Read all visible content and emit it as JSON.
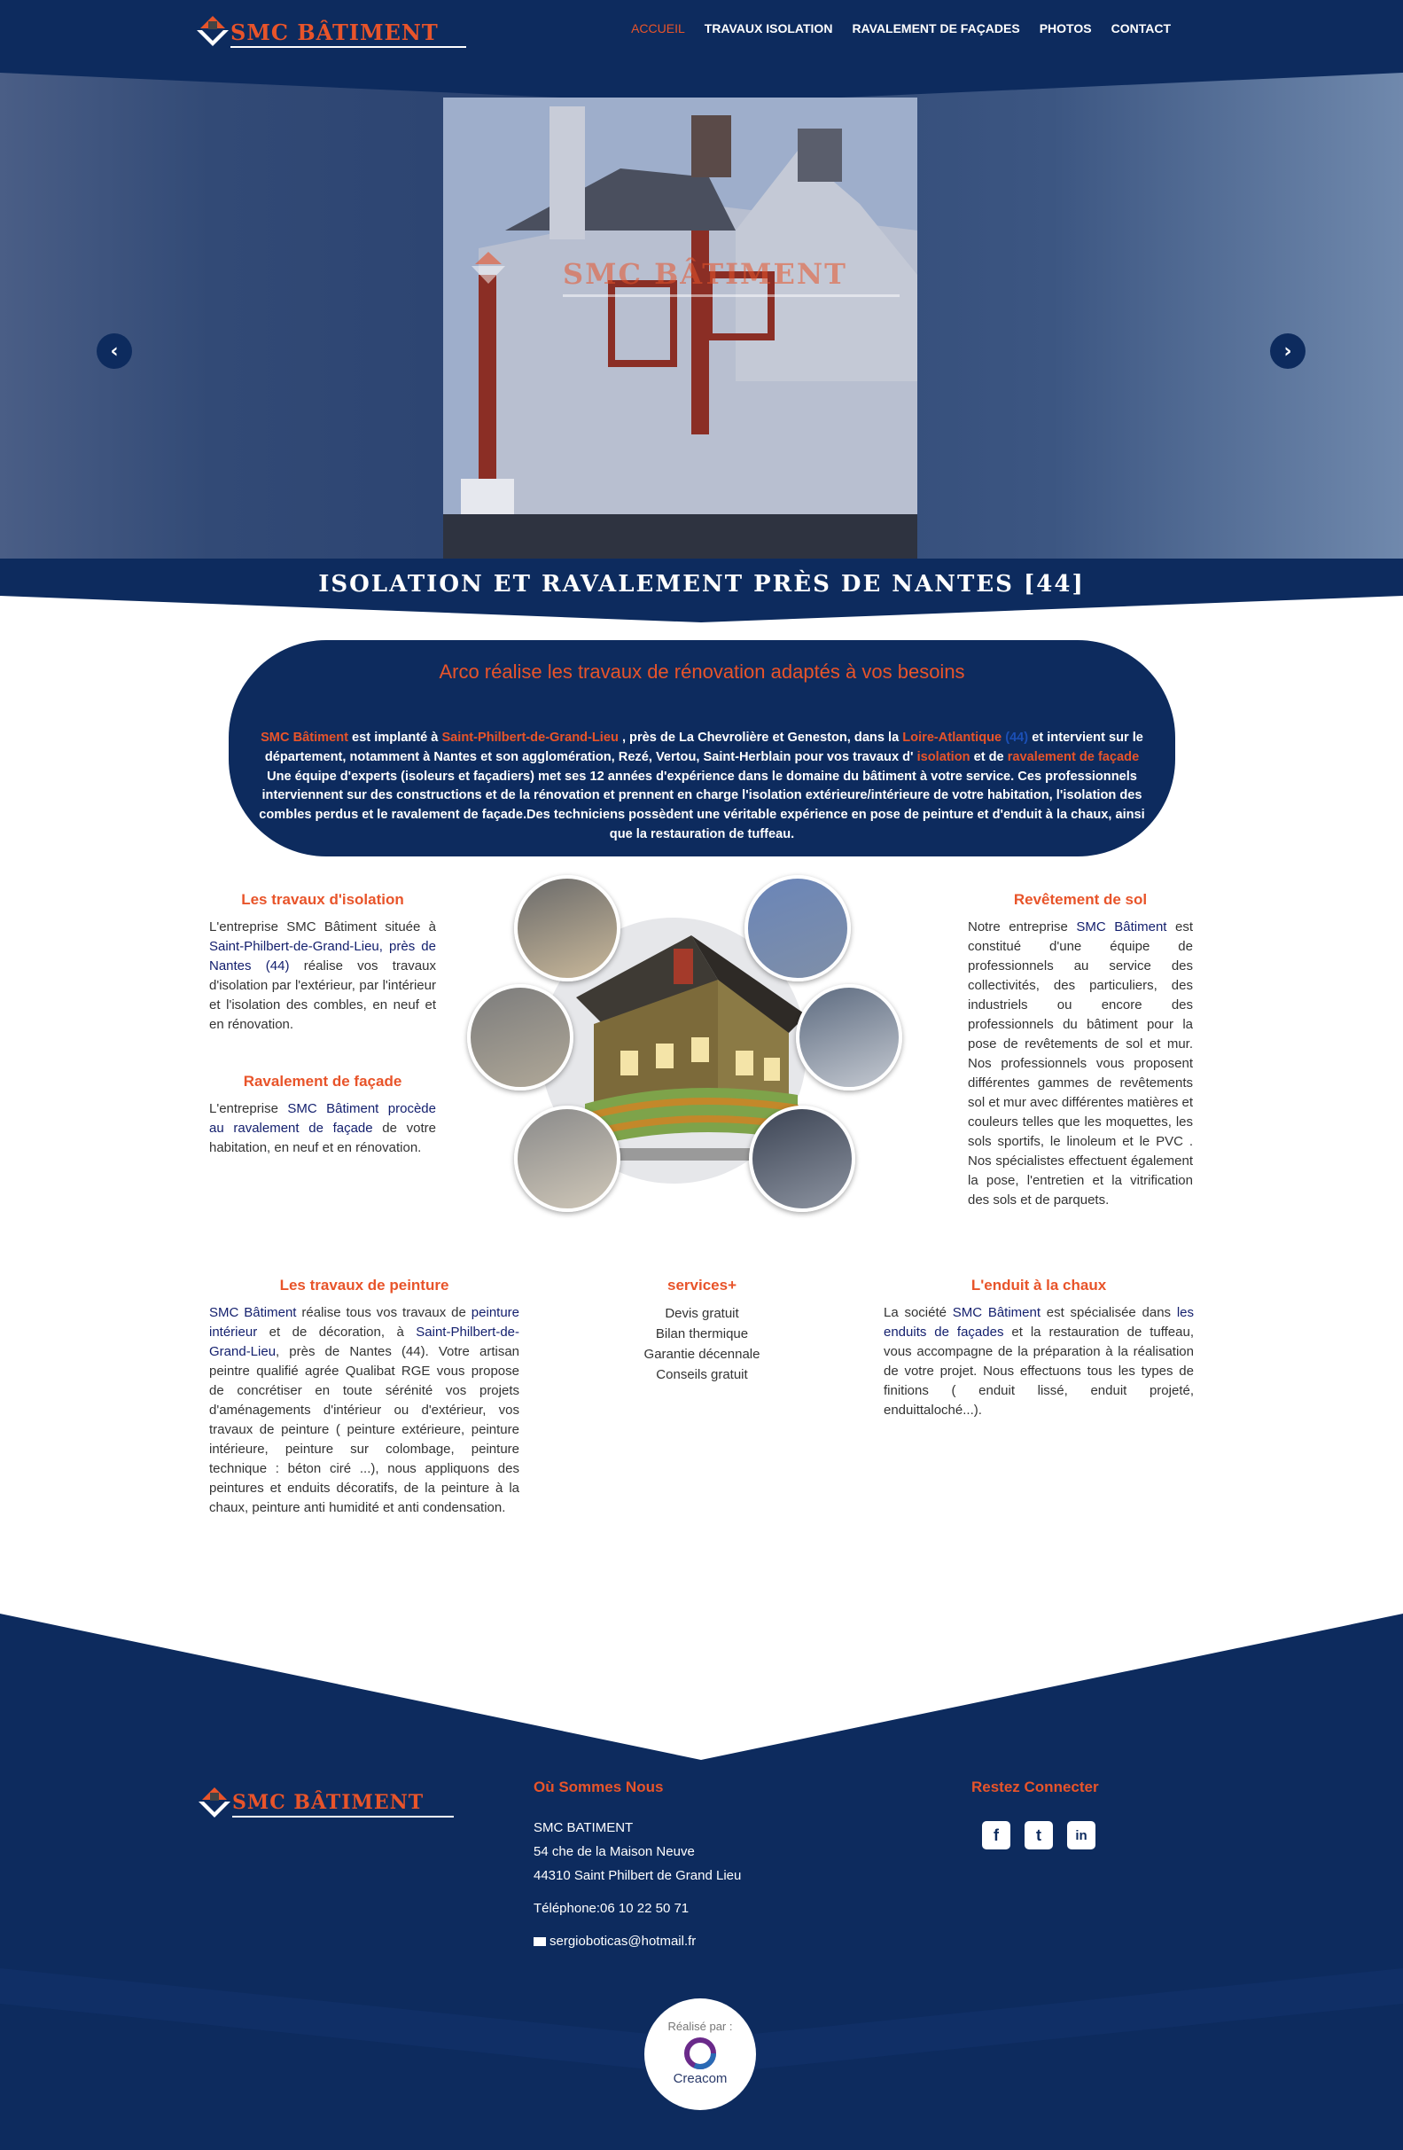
{
  "header": {
    "logo_text": "SMC BÂTIMENT",
    "nav": [
      {
        "label": "ACCUEIL",
        "active": true
      },
      {
        "label": "TRAVAUX ISOLATION",
        "active": false
      },
      {
        "label": "RAVALEMENT DE FAÇADES",
        "active": false
      },
      {
        "label": "PHOTOS",
        "active": false
      },
      {
        "label": "CONTACT",
        "active": false
      }
    ]
  },
  "hero": {
    "watermark": "SMC BÂTIMENT",
    "prev_icon": "chevron-left-icon",
    "next_icon": "chevron-right-icon"
  },
  "banner": {
    "title": "ISOLATION ET RAVALEMENT PRÈS DE NANTES [44]"
  },
  "intro": {
    "title": "Arco réalise les travaux de rénovation adaptés à vos besoins",
    "p1_company": "SMC Bâtiment",
    "p1_a": " est implanté à ",
    "p1_city": "Saint-Philbert-de-Grand-Lieu",
    "p1_b": " , près de La Chevrolière et Geneston, dans la ",
    "p1_region": "Loire-Atlantique",
    "p1_dept": "(44)",
    "p1_c": " et intervient sur le département, notamment à Nantes et son agglomération, Rezé, Vertou, Saint-Herblain pour vos travaux d' ",
    "p1_isolation": "isolation",
    "p1_d": " et de ",
    "p1_ravalement": "ravalement de façade",
    "p1_e": " Une équipe d'experts (isoleurs et façadiers) met ses 12 années d'expérience dans le domaine du bâtiment à votre service. Ces professionnels interviennent sur des constructions et de la rénovation et prennent en charge l'isolation extérieure/intérieure de votre habitation, l'isolation des combles perdus et le ravalement de façade.Des techniciens possèdent une véritable expérience en pose de peinture et d'enduit à la chaux, ainsi que la restauration de tuffeau."
  },
  "isolation": {
    "title": "Les travaux d'isolation",
    "a": "L'entreprise SMC Bâtiment située à ",
    "kw1": "Saint-Philbert-de-Grand-Lieu, près de Nantes (44)",
    "b": " réalise vos travaux d'isolation par l'extérieur, par l'intérieur et l'isolation des combles, en neuf et en rénovation."
  },
  "ravalement": {
    "title": "Ravalement de façade",
    "a": "L'entreprise ",
    "kw1": "SMC Bâtiment procède au ravalement de façade",
    "b": " de votre habitation, en neuf et en rénovation."
  },
  "sol": {
    "title": "Revêtement de sol",
    "a": "Notre entreprise ",
    "kw1": "SMC Bâtiment",
    "b": " est constitué d'une équipe de professionnels au service des collectivités, des particuliers, des industriels ou encore des professionnels du bâtiment pour la pose de revêtements de sol et mur. Nos professionnels vous proposent différentes gammes de revêtements sol et mur avec différentes matières et couleurs telles que les moquettes, les sols sportifs, le linoleum et le PVC . Nos spécialistes effectuent également la pose, l'entretien et la vitrification des sols et de parquets."
  },
  "peinture": {
    "title": "Les travaux de peinture",
    "kw1": "SMC Bâtiment",
    "a": " réalise tous vos travaux de ",
    "kw2": "peinture intérieur",
    "b": " et de décoration, à ",
    "kw3": "Saint-Philbert-de-Grand-Lieu",
    "c": ", près de Nantes (44). Votre artisan peintre qualifié agrée Qualibat RGE vous propose de concrétiser en toute sérénité vos projets d'aménagements d'intérieur ou d'extérieur, vos travaux de peinture ( peinture extérieure, peinture intérieure, peinture sur colombage, peinture technique : béton ciré ...), nous appliquons des peintures et enduits décoratifs, de la peinture à la chaux, peinture anti humidité et anti condensation."
  },
  "services": {
    "title": "services+",
    "items": [
      "Devis gratuit",
      "Bilan thermique",
      "Garantie décennale",
      "Conseils gratuit"
    ]
  },
  "enduit": {
    "title": "L'enduit à la chaux",
    "a": "La société ",
    "kw1": "SMC Bâtiment",
    "b": " est spécialisée dans ",
    "kw2": "les enduits de façades",
    "c": " et la restauration de tuffeau, vous accompagne de la préparation à la réalisation de votre projet. Nous effectuons tous les types de finitions ( enduit lissé, enduit projeté, enduittaloché...)."
  },
  "footer": {
    "logo_text": "SMC BÂTIMENT",
    "where_title": "Où Sommes Nous",
    "company": "SMC BATIMENT",
    "street": "54 che de la Maison Neuve",
    "city": "44310 Saint Philbert de Grand Lieu",
    "phone": "Téléphone:06 10 22 50 71",
    "email": "sergioboticas@hotmail.fr",
    "social_title": "Restez Connecter",
    "social": [
      "facebook-icon",
      "twitter-icon",
      "linkedin-icon"
    ],
    "credit_label": "Réalisé par :",
    "credit_name": "Creacom"
  },
  "colors": {
    "navy": "#0d2b5e",
    "accent": "#e8542a",
    "keyword": "#14206e"
  }
}
